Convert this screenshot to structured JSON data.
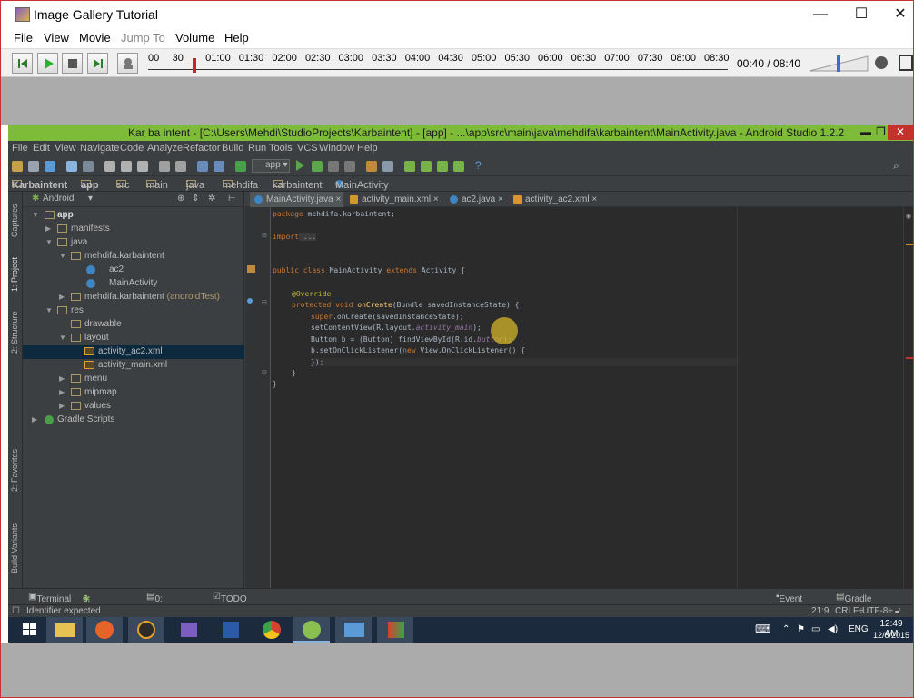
{
  "player": {
    "title": "Image Gallery Tutorial",
    "menu": [
      "File",
      "View",
      "Movie",
      "Jump To",
      "Volume",
      "Help"
    ],
    "timeline_ticks": [
      "00",
      "30",
      "01:00",
      "01:30",
      "02:00",
      "02:30",
      "03:00",
      "03:30",
      "04:00",
      "04:30",
      "05:00",
      "05:30",
      "06:00",
      "06:30",
      "07:00",
      "07:30",
      "08:00",
      "08:30"
    ],
    "time_readout": "00:40 / 08:40",
    "playback_progress": 0.077
  },
  "studio": {
    "title": "Kar ba intent - [C:\\Users\\Mehdi\\StudioProjects\\Karbaintent] - [app] - ...\\app\\src\\main\\java\\mehdifa\\karbaintent\\MainActivity.java - Android Studio 1.2.2",
    "menu": [
      "File",
      "Edit",
      "View",
      "Navigate",
      "Code",
      "Analyze",
      "Refactor",
      "Build",
      "Run",
      "Tools",
      "VCS",
      "Window",
      "Help"
    ],
    "run_config": "app",
    "breadcrumbs": [
      "Karbaintent",
      "app",
      "src",
      "main",
      "java",
      "mehdifa",
      "karbaintent",
      "MainActivity"
    ],
    "side_tabs": [
      "Captures",
      "1: Project",
      "2: Structure",
      "2: Favorites",
      "Build Variants"
    ],
    "project_view": "Android",
    "tree": [
      {
        "label": "app",
        "level": 0
      },
      {
        "label": "manifests",
        "level": 1
      },
      {
        "label": "java",
        "level": 1
      },
      {
        "label": "mehdifa.karbaintent",
        "level": 2
      },
      {
        "label": "ac2",
        "level": 3
      },
      {
        "label": "MainActivity",
        "level": 3
      },
      {
        "label": "mehdifa.karbaintent",
        "suffix": "(androidTest)",
        "level": 2
      },
      {
        "label": "res",
        "level": 1
      },
      {
        "label": "drawable",
        "level": 2
      },
      {
        "label": "layout",
        "level": 2
      },
      {
        "label": "activity_ac2.xml",
        "level": 3,
        "selected": true
      },
      {
        "label": "activity_main.xml",
        "level": 3
      },
      {
        "label": "menu",
        "level": 2
      },
      {
        "label": "mipmap",
        "level": 2
      },
      {
        "label": "values",
        "level": 2
      },
      {
        "label": "Gradle Scripts",
        "level": 0
      }
    ],
    "tabs": [
      {
        "label": "MainActivity.java",
        "active": true
      },
      {
        "label": "activity_main.xml"
      },
      {
        "label": "ac2.java"
      },
      {
        "label": "activity_ac2.xml"
      }
    ],
    "code": {
      "l1": [
        "package",
        " mehdifa.karbaintent;"
      ],
      "l2": [
        "import",
        " ..."
      ],
      "l3": [
        "public class",
        " MainActivity ",
        "extends",
        " Activity {"
      ],
      "l4": [
        "@Override"
      ],
      "l5": [
        "protected void",
        " onCreate",
        "(Bundle savedInstanceState) {"
      ],
      "l6": [
        "super",
        ".onCreate(savedInstanceState);"
      ],
      "l7": [
        "setContentView(R.layout.",
        "activity_main",
        ");"
      ],
      "l8": [
        "Button b = (Button) findViewById(R.id.",
        "button",
        ");"
      ],
      "l9": [
        "b.setOnClickListener(",
        "new",
        " View.OnClickListener() {"
      ],
      "l10": [
        "});"
      ],
      "l11": [
        "}"
      ],
      "l12": [
        "}"
      ]
    },
    "tool_tabs": [
      "Terminal",
      "6: Android",
      "0: Messages",
      "TODO",
      "Event Log",
      "Gradle Console"
    ],
    "status": {
      "message": "Identifier expected",
      "position": "21:9",
      "line_sep": "CRLF÷",
      "encoding": "UTF-8÷"
    }
  },
  "taskbar": {
    "lang": "ENG",
    "time": "12:49 AM",
    "date": "12/8/2015"
  }
}
